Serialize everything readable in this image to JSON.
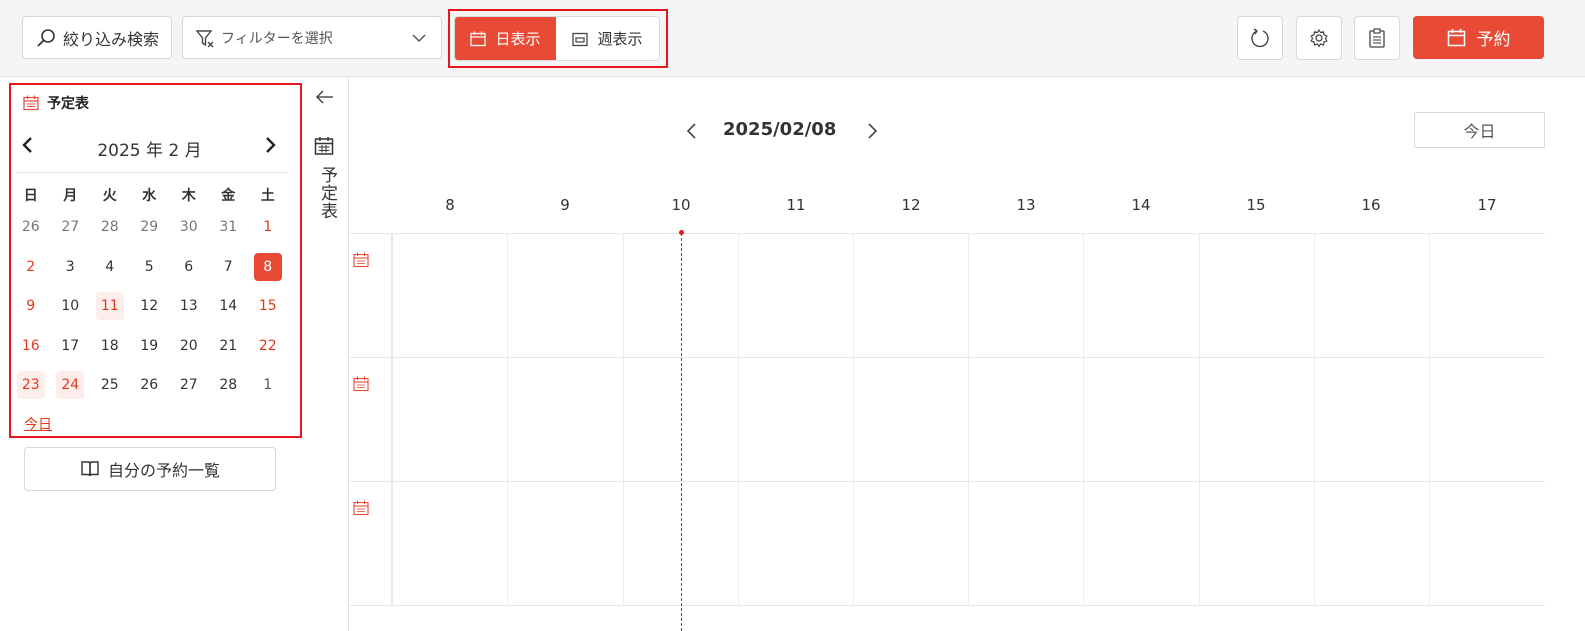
{
  "toolbar": {
    "search_label": "絞り込み検索",
    "filter_placeholder": "フィルターを選択",
    "view_day_label": "日表示",
    "view_week_label": "週表示",
    "reserve_label": "予約"
  },
  "calendar": {
    "title": "予定表",
    "month_label": "2025 年 2 月",
    "weekdays": [
      "日",
      "月",
      "火",
      "水",
      "木",
      "金",
      "土"
    ],
    "weeks": [
      [
        "26",
        "27",
        "28",
        "29",
        "30",
        "31",
        "1"
      ],
      [
        "2",
        "3",
        "4",
        "5",
        "6",
        "7",
        "8"
      ],
      [
        "9",
        "10",
        "11",
        "12",
        "13",
        "14",
        "15"
      ],
      [
        "16",
        "17",
        "18",
        "19",
        "20",
        "21",
        "22"
      ],
      [
        "23",
        "24",
        "25",
        "26",
        "27",
        "28",
        "1"
      ]
    ],
    "selected_day": "8",
    "today_label": "今日"
  },
  "my_list_label": "自分の予約一覧",
  "side_strip_label": "予定表",
  "schedule": {
    "date_label": "2025/02/08",
    "today_button": "今日",
    "hours": [
      "8",
      "9",
      "10",
      "11",
      "12",
      "13",
      "14",
      "15",
      "16",
      "17"
    ]
  },
  "colors": {
    "accent": "#e84a36",
    "highlight_border": "#e5161e"
  },
  "icons": {
    "search": "search-icon",
    "filter": "filter-icon",
    "calendar": "calendar-icon",
    "refresh": "refresh-icon",
    "settings": "gear-icon",
    "clipboard": "clipboard-icon",
    "book": "book-icon",
    "back": "arrow-left-icon"
  }
}
